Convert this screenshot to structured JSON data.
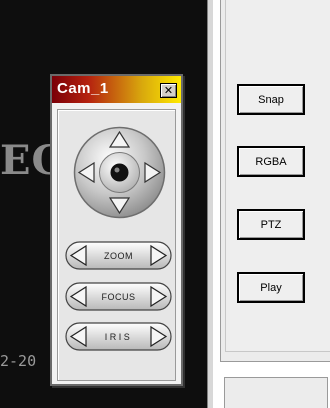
{
  "video": {
    "overlay_text": "EC",
    "timestamp_text": "2-20"
  },
  "controls": {
    "snap_label": "Snap",
    "rgba_label": "RGBA",
    "ptz_label": "PTZ",
    "play_label": "Play"
  },
  "ptz_window": {
    "title": "Cam_1",
    "close_glyph": "✕",
    "zoom_label": "ZOOM",
    "focus_label": "FOCUS",
    "iris_label": "IRIS"
  },
  "icons": {
    "joystick": "directional-pad-icon",
    "arrows": [
      "chevron-up-icon",
      "chevron-down-icon",
      "chevron-left-icon",
      "chevron-right-icon"
    ]
  },
  "colors": {
    "title_gradient_start": "#7a0008",
    "title_gradient_end": "#ffea00",
    "video_bg": "#0e0e0e",
    "panel_bg": "#ececec"
  }
}
